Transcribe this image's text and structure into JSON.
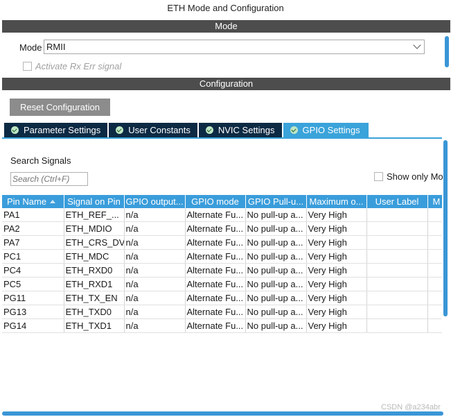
{
  "window": {
    "title": "ETH Mode and Configuration"
  },
  "mode_section": {
    "header": "Mode",
    "mode_label": "Mode",
    "mode_value": "RMII",
    "activate_rx_err_label": "Activate Rx Err signal"
  },
  "config_section": {
    "header": "Configuration",
    "reset_button": "Reset Configuration",
    "tabs": [
      {
        "label": "Parameter Settings",
        "icon": "check-circle-icon"
      },
      {
        "label": "User Constants",
        "icon": "check-circle-icon"
      },
      {
        "label": "NVIC Settings",
        "icon": "check-circle-icon"
      },
      {
        "label": "GPIO Settings",
        "icon": "check-circle-icon",
        "active": true
      }
    ],
    "search_label": "Search Signals",
    "search_placeholder": "Search (Ctrl+F)",
    "show_only_label": "Show only Mo"
  },
  "table": {
    "columns": [
      "Pin Name",
      "Signal on Pin",
      "GPIO output...",
      "GPIO mode",
      "GPIO Pull-u...",
      "Maximum o...",
      "User Label",
      "M"
    ],
    "rows": [
      [
        "PA1",
        "ETH_REF_...",
        "n/a",
        "Alternate Fu...",
        "No pull-up a...",
        "Very High",
        ""
      ],
      [
        "PA2",
        "ETH_MDIO",
        "n/a",
        "Alternate Fu...",
        "No pull-up a...",
        "Very High",
        ""
      ],
      [
        "PA7",
        "ETH_CRS_DV",
        "n/a",
        "Alternate Fu...",
        "No pull-up a...",
        "Very High",
        ""
      ],
      [
        "PC1",
        "ETH_MDC",
        "n/a",
        "Alternate Fu...",
        "No pull-up a...",
        "Very High",
        ""
      ],
      [
        "PC4",
        "ETH_RXD0",
        "n/a",
        "Alternate Fu...",
        "No pull-up a...",
        "Very High",
        ""
      ],
      [
        "PC5",
        "ETH_RXD1",
        "n/a",
        "Alternate Fu...",
        "No pull-up a...",
        "Very High",
        ""
      ],
      [
        "PG11",
        "ETH_TX_EN",
        "n/a",
        "Alternate Fu...",
        "No pull-up a...",
        "Very High",
        ""
      ],
      [
        "PG13",
        "ETH_TXD0",
        "n/a",
        "Alternate Fu...",
        "No pull-up a...",
        "Very High",
        ""
      ],
      [
        "PG14",
        "ETH_TXD1",
        "n/a",
        "Alternate Fu...",
        "No pull-up a...",
        "Very High",
        ""
      ]
    ]
  },
  "watermark": "CSDN @a234abr",
  "colors": {
    "header_bar": "#4d4d4d",
    "tab_dark": "#0d2a44",
    "tab_active": "#3aa3da",
    "table_header": "#3a9ddb",
    "scrollbar": "#3a96d6"
  }
}
